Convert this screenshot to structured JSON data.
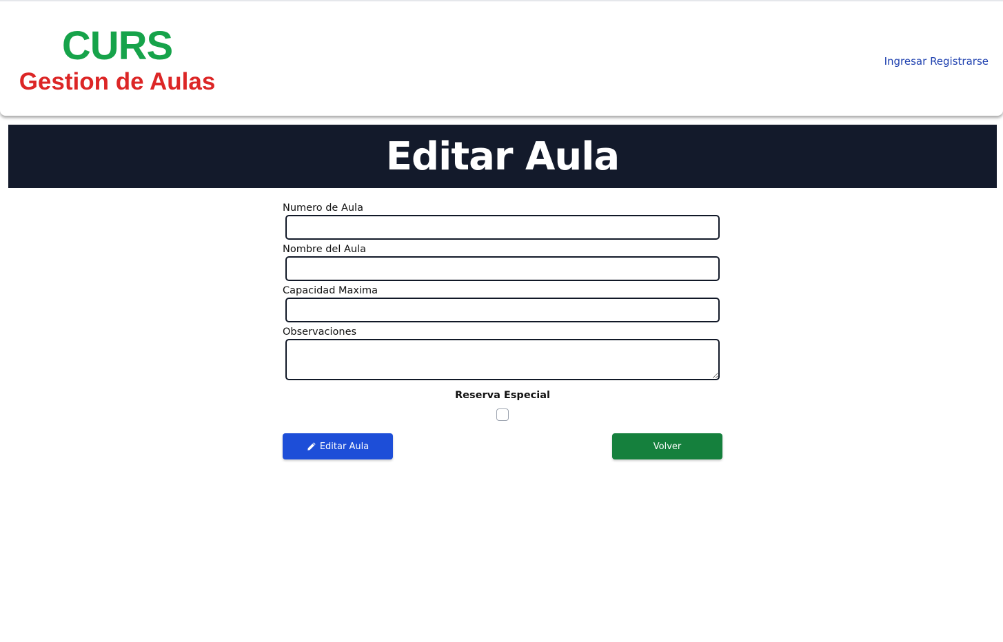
{
  "header": {
    "brand_title": "CURS",
    "brand_subtitle": "Gestion de Aulas",
    "nav": {
      "login": "Ingresar",
      "register": "Registrarse"
    }
  },
  "banner": {
    "title": "Editar Aula"
  },
  "form": {
    "fields": [
      {
        "label": "Numero de Aula",
        "value": ""
      },
      {
        "label": "Nombre del Aula",
        "value": ""
      },
      {
        "label": "Capacidad Maxima",
        "value": ""
      },
      {
        "label": "Observaciones",
        "value": ""
      }
    ],
    "checkbox": {
      "label": "Reserva Especial",
      "checked": false
    },
    "buttons": {
      "submit": "Editar Aula",
      "back": "Volver"
    }
  },
  "colors": {
    "brand_green": "#16a34a",
    "brand_red": "#dc2626",
    "nav_link": "#1e40af",
    "banner_bg": "#131a2b",
    "submit_button": "#1d4ed8",
    "back_button": "#15803d"
  },
  "icons": {
    "submit_icon": "pencil-icon"
  }
}
